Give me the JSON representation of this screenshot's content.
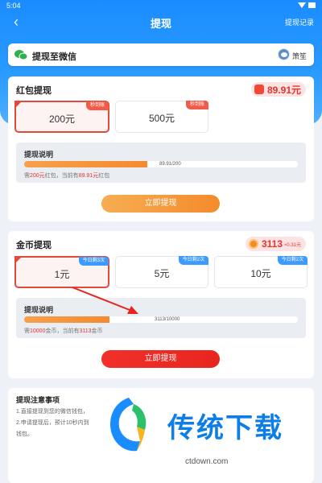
{
  "status": {
    "time": "5:04"
  },
  "nav": {
    "title": "提现",
    "record": "提现记录",
    "back_icon": "chevron-left-icon"
  },
  "wechat": {
    "label": "提现至微信",
    "username": "箫笙",
    "icon": "wechat-icon"
  },
  "redpacket": {
    "title": "红包提现",
    "balance": "89.91元",
    "options": [
      {
        "label": "200元",
        "tag": "秒到账",
        "selected": true
      },
      {
        "label": "500元",
        "tag": "秒到账",
        "selected": false
      }
    ],
    "info_title": "提现说明",
    "progress_text": "89.91/200",
    "progress_fraction": 0.4496,
    "note_prefix": "需",
    "note_need": "200元",
    "note_mid": "红包，当前有",
    "note_have": "89.91元",
    "note_suffix": "红包",
    "button": "立即提现"
  },
  "coin": {
    "title": "金币提现",
    "balance": "3113",
    "balance_sub": "≈0.31元",
    "options": [
      {
        "label": "1元",
        "tag": "今日剩3次",
        "selected": true
      },
      {
        "label": "5元",
        "tag": "今日剩2次",
        "selected": false
      },
      {
        "label": "10元",
        "tag": "今日剩2次",
        "selected": false
      }
    ],
    "info_title": "提现说明",
    "progress_text": "3113/10000",
    "progress_fraction": 0.3113,
    "note_prefix": "需",
    "note_need": "10000",
    "note_mid": "金币，当前有",
    "note_have": "3113",
    "note_suffix": "金币",
    "button": "立即提现"
  },
  "notes": {
    "title": "提现注意事项",
    "lines": [
      "1.直接提现到您的微信钱包，",
      "2.申请提现后，预计10秒内到",
      "钱包。"
    ]
  },
  "watermark": {
    "text": "传统下载",
    "url": "ctdown.com"
  },
  "colors": {
    "primary": "#1a8cff",
    "accent_red": "#e9322b",
    "orange": "#f38b2c",
    "watermark_blue": "#0d7ee8"
  }
}
